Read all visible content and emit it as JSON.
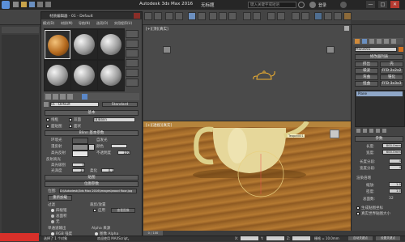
{
  "window": {
    "title": "Autodesk 3ds Max 2016",
    "title_suffix": "无标题",
    "search_placeholder": "键入关键字或短语",
    "account_label": "登录",
    "minimize": "—",
    "maximize": "□",
    "close": "✕"
  },
  "material_editor": {
    "title": "材质编辑器 - 01 - Default",
    "menu": [
      "模式(D)",
      "材质(M)",
      "导航(N)",
      "选项(O)",
      "实用程序(U)"
    ],
    "material_name": "01 - Default",
    "material_type": "Standard",
    "sections": {
      "basic_params": "基本",
      "shader_type": "(B)Blinn",
      "wire": "线框",
      "two_sided": "双面",
      "face_map": "面贴图",
      "faceted": "面状",
      "blinn_basic_params": "Blinn 基本参数",
      "ambient": "环境光",
      "diffuse": "漫反射",
      "specular": "高光反射",
      "self_illum": "自发光",
      "color": "颜色",
      "opacity": "不透明度",
      "opacity_value": "100",
      "specular_highlights": "反射高光",
      "spec_level": "高光级别",
      "spec_level_value": "0",
      "glossiness": "光泽度",
      "glossiness_value": "10",
      "soften": "柔化",
      "soften_value": "0.1",
      "maps_rollout": "贴图",
      "bitmap_params": "位图参数",
      "bitmap_label": "位图:",
      "bitmap_path": "D:\\Autodesk\\3ds Max 2016\\images\\wood floor.jpg",
      "reload": "重新加载",
      "filtering": "过滤",
      "pyramidal": "四棱锥",
      "summed_area": "总面积",
      "none": "无",
      "cropping": "裁剪/放置",
      "apply": "应用",
      "view_image": "查看图像",
      "single_channel": "单通道输出",
      "rgb_intensity": "RGB 强度",
      "alpha": "Alpha",
      "rgb_channel_output": "RGB 通道输出",
      "alpha_source": "Alpha 来源",
      "image_alpha": "图像 Alpha",
      "premultiplied": "预乘 Alpha"
    }
  },
  "viewports": {
    "top_label": "[+][顶][真实]",
    "persp_label": "[+][透视][真实]",
    "tooltip_text": "Teapot001"
  },
  "command_panel": {
    "object_name": "Plane001",
    "modifier_list": "修改器列表",
    "buttons": [
      "挤出",
      "壳",
      "噪波",
      "FFD 2x2x2",
      "弯曲",
      "锥化",
      "扭曲",
      "FFD 3x3x3"
    ],
    "stack_item": "Plane",
    "params_title": "参数",
    "length_label": "长度:",
    "length_value": "800.0mm",
    "width_label": "宽度:",
    "width_value": "600.0mm",
    "length_segs_label": "长度分段:",
    "length_segs_value": "4",
    "width_segs_label": "宽度分段:",
    "width_segs_value": "4",
    "render_multipliers": "渲染倍增",
    "scale_label": "缩放:",
    "scale_value": "1.0",
    "density_label": "密度:",
    "density_value": "1.0",
    "total_faces_label": "总面数:",
    "total_faces_value": "32",
    "gen_mapping": "生成贴图坐标",
    "real_world": "真实世界贴图大小"
  },
  "timeline": {
    "frame": "0 / 100"
  },
  "status": {
    "welcome": "欢迎使用 MAXScript。",
    "selected": "选择了 1 个对象",
    "x_label": "X:",
    "y_label": "Y:",
    "z_label": "Z:",
    "grid": "栅格 = 10.0mm",
    "auto_key": "自动关键点",
    "set_key": "设置关键点"
  },
  "colors": {
    "accent_red": "#d8302a",
    "floor": "#9a6426",
    "teapot": "#e6d79a",
    "viewport_bg": "#4a4a4a"
  }
}
